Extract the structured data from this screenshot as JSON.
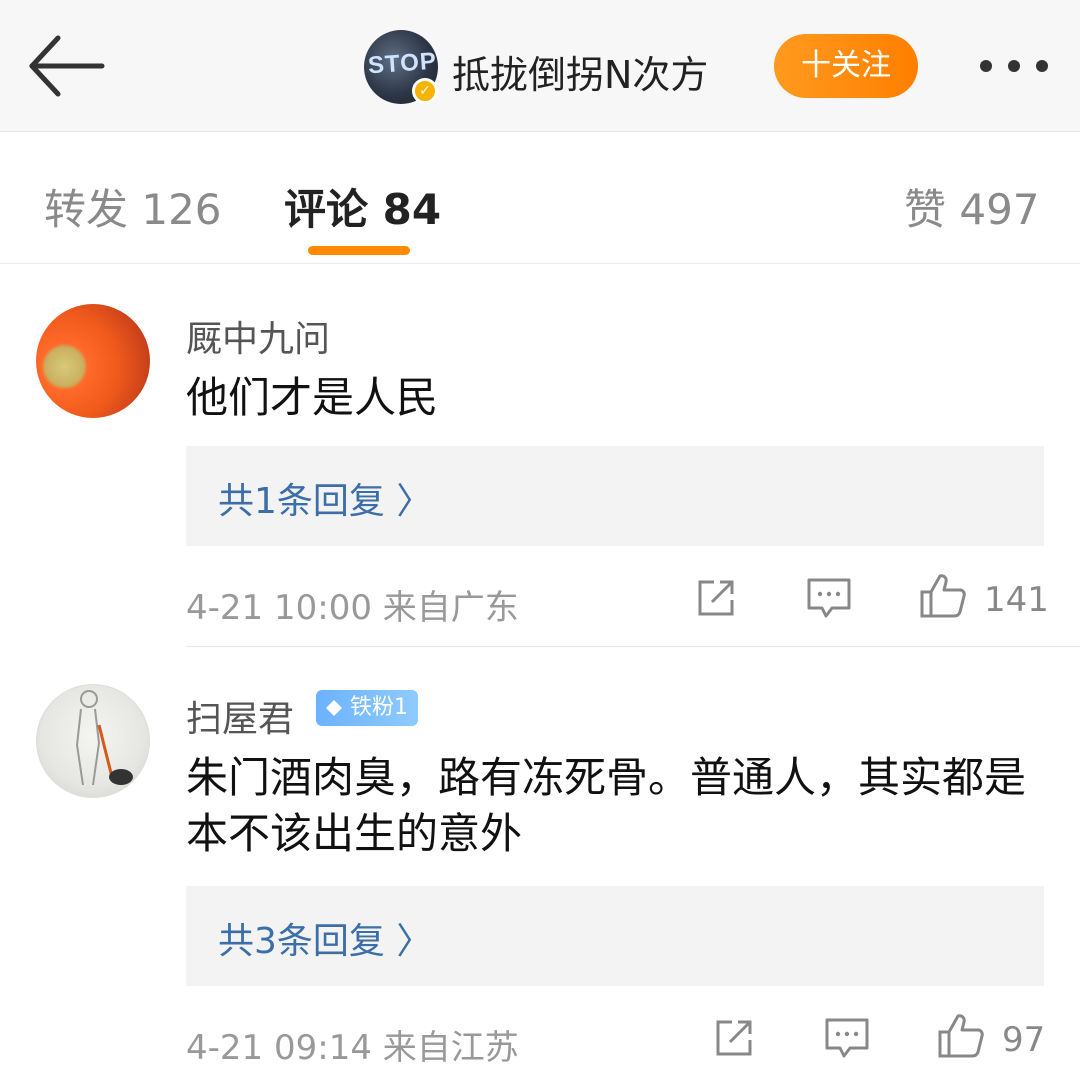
{
  "header": {
    "back_icon": "arrow-left-icon",
    "username": "抵拢倒拐N次方",
    "avatar_text": "STOP",
    "follow_label": "十关注",
    "more_icon": "more-dots-icon"
  },
  "tabs": [
    {
      "label": "转发 126",
      "active": false
    },
    {
      "label": "评论 84",
      "active": true
    },
    {
      "label": "赞 497",
      "active": false
    }
  ],
  "colors": {
    "accent": "#ff8a00",
    "link": "#3c6ea8"
  },
  "comments": [
    {
      "username": "厩中九问",
      "text": "他们才是人民",
      "reply_label": "共1条回复 〉",
      "meta": "4-21 10:00  来自广东",
      "likes": "141"
    },
    {
      "username": "扫屋君",
      "badge": "铁粉1",
      "text": "朱门酒肉臭，路有冻死骨。普通人，其实都是本不该出生的意外",
      "reply_label": "共3条回复 〉",
      "meta": "4-21 09:14  来自江苏",
      "likes": "97"
    }
  ]
}
